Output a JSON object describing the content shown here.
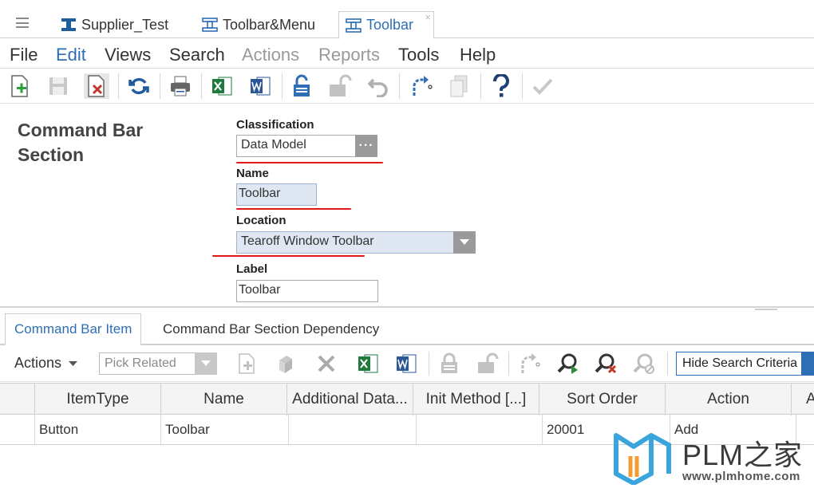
{
  "tabs": [
    {
      "label": "Supplier_Test",
      "icon": "itemtype-icon"
    },
    {
      "label": "Toolbar&Menu",
      "icon": "relationship-icon"
    },
    {
      "label": "Toolbar",
      "icon": "relationship-icon",
      "close": "×"
    }
  ],
  "menu": [
    "File",
    "Edit",
    "Views",
    "Search",
    "Actions",
    "Reports",
    "Tools",
    "Help"
  ],
  "toolbar_icons": [
    "new-icon",
    "save-icon",
    "delete-icon",
    "refresh-icon",
    "print-icon",
    "excel-icon",
    "word-icon",
    "lock-icon",
    "unlock-icon",
    "undo-icon",
    "promote-icon",
    "version-icon",
    "help-icon",
    "done-icon"
  ],
  "form": {
    "title": "Command Bar Section",
    "classification_label": "Classification",
    "classification_value": "Data Model",
    "ellipsis": "···",
    "name_label": "Name",
    "name_value": "Toolbar",
    "location_label": "Location",
    "location_value": "Tearoff Window Toolbar",
    "label_label": "Label",
    "label_value": "Toolbar"
  },
  "subtabs": [
    "Command Bar Item",
    "Command Bar Section Dependency"
  ],
  "grid_toolbar": {
    "actions": "Actions",
    "pick_related": "Pick Related",
    "hide_search": "Hide Search Criteria"
  },
  "grid": {
    "columns": [
      "ItemType",
      "Name",
      "Additional Data...",
      "Init Method [...]",
      "Sort Order",
      "Action",
      "A"
    ],
    "rows": [
      [
        "Button",
        "Toolbar",
        "",
        "",
        "20001",
        "Add"
      ]
    ]
  },
  "watermark": {
    "title": "PLM之家",
    "url": "www.plmhome.com"
  },
  "colors": {
    "accent": "#2e6eb5",
    "underline": "#e01818",
    "excel": "#1f7a3e",
    "word": "#2b5797"
  }
}
